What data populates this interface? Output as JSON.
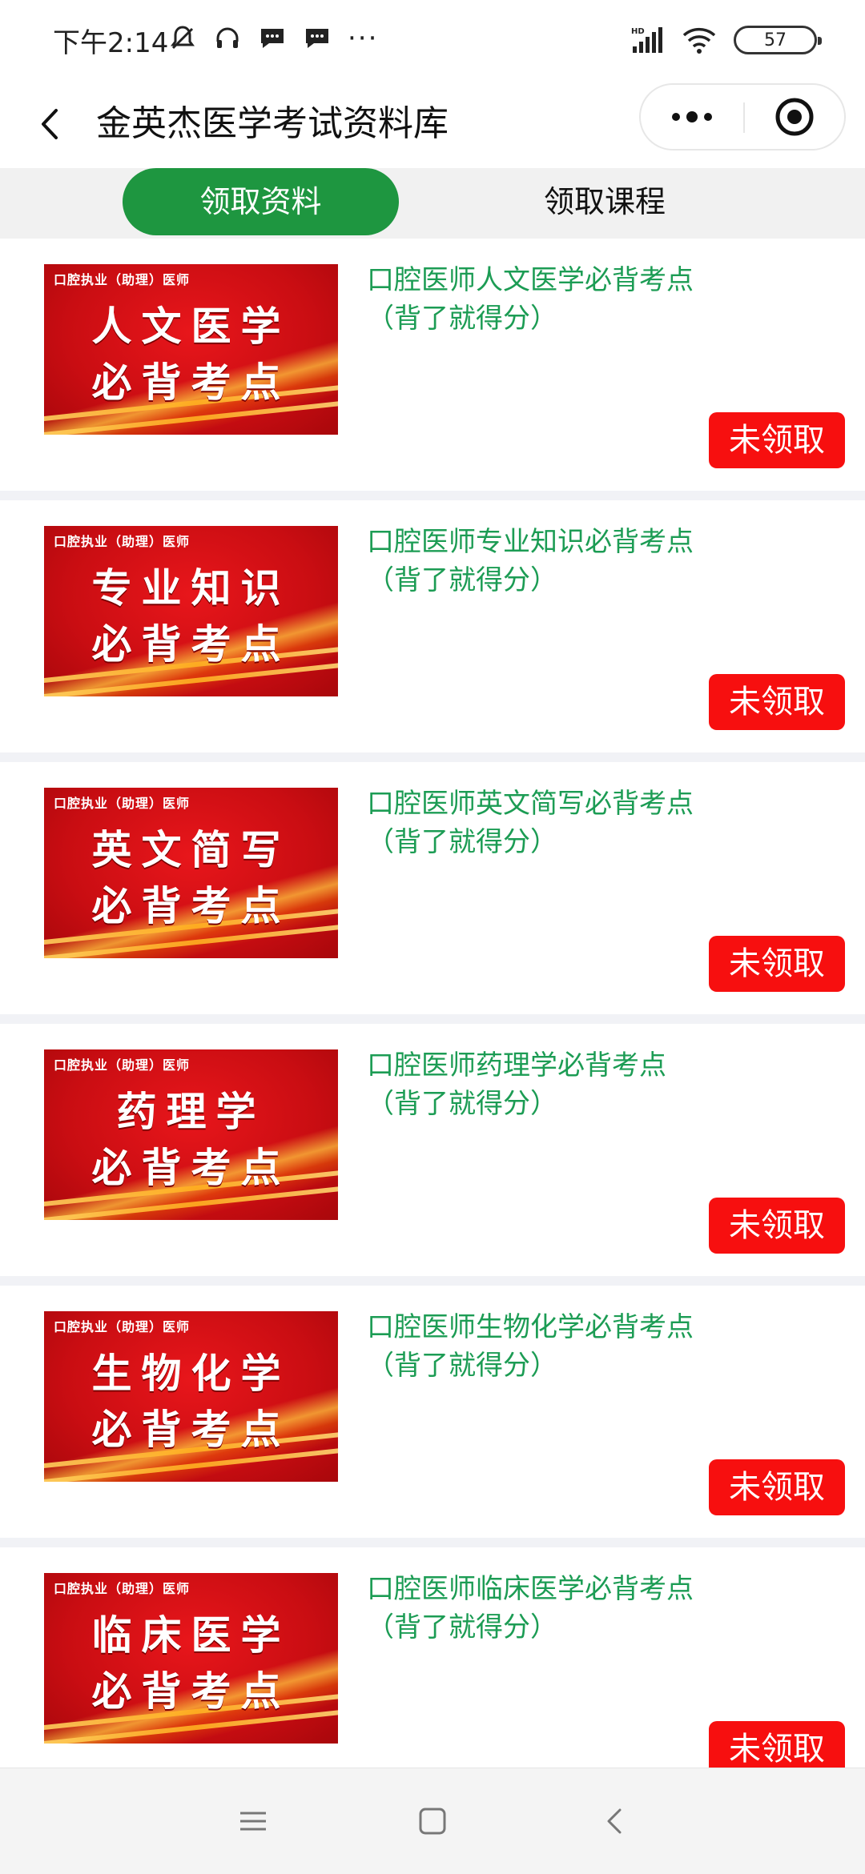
{
  "status_bar": {
    "time": "下午2:14",
    "overflow": "···",
    "battery": "57",
    "icons": [
      "mute-icon",
      "headset-icon",
      "message-icon",
      "message-icon",
      "signal-hd-icon",
      "wifi-icon",
      "battery-icon"
    ]
  },
  "nav": {
    "title": "金英杰医学考试资料库",
    "back_icon": "chevron-left-icon",
    "more_icon": "more-dots-icon",
    "close_icon": "target-close-icon"
  },
  "tabs": [
    {
      "label": "领取资料",
      "active": true
    },
    {
      "label": "领取课程",
      "active": false
    }
  ],
  "items": [
    {
      "thumb_small": "口腔执业（助理）医师",
      "thumb_line1": "人文医学",
      "thumb_line2": "必背考点",
      "title_line1": "口腔医师人文医学必背考点",
      "title_line2": "（背了就得分）",
      "button": "未领取"
    },
    {
      "thumb_small": "口腔执业（助理）医师",
      "thumb_line1": "专业知识",
      "thumb_line2": "必背考点",
      "title_line1": "口腔医师专业知识必背考点",
      "title_line2": "（背了就得分）",
      "button": "未领取"
    },
    {
      "thumb_small": "口腔执业（助理）医师",
      "thumb_line1": "英文简写",
      "thumb_line2": "必背考点",
      "title_line1": "口腔医师英文简写必背考点",
      "title_line2": "（背了就得分）",
      "button": "未领取"
    },
    {
      "thumb_small": "口腔执业（助理）医师",
      "thumb_line1": "药理学",
      "thumb_line2": "必背考点",
      "title_line1": "口腔医师药理学必背考点",
      "title_line2": "（背了就得分）",
      "button": "未领取"
    },
    {
      "thumb_small": "口腔执业（助理）医师",
      "thumb_line1": "生物化学",
      "thumb_line2": "必背考点",
      "title_line1": "口腔医师生物化学必背考点",
      "title_line2": "（背了就得分）",
      "button": "未领取"
    },
    {
      "thumb_small": "口腔执业（助理）医师",
      "thumb_line1": "临床医学",
      "thumb_line2": "必背考点",
      "title_line1": "口腔医师临床医学必背考点",
      "title_line2": "（背了就得分）",
      "button": "未领取"
    }
  ],
  "system_nav": {
    "icons": [
      "menu-icon",
      "home-square-icon",
      "back-triangle-icon"
    ]
  },
  "colors": {
    "accent_green": "#1e9640",
    "title_green": "#1c9c54",
    "button_red": "#f70f0f"
  }
}
